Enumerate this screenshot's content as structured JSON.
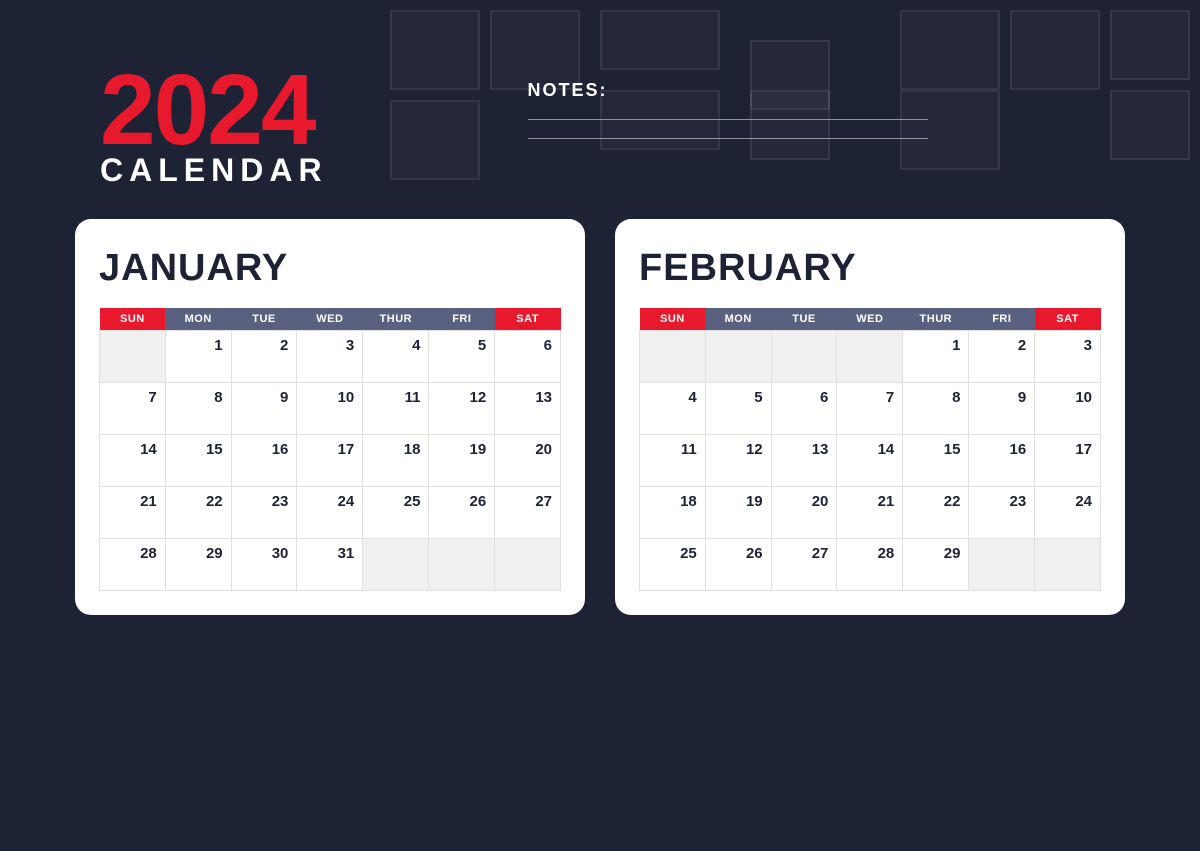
{
  "background": {
    "color": "#1e2235"
  },
  "header": {
    "year": "2024",
    "calendar_label": "CALENDAR",
    "notes_label": "NOTES:"
  },
  "january": {
    "title": "JANUARY",
    "days_header": [
      "SUN",
      "MON",
      "TUE",
      "WED",
      "THUR",
      "FRI",
      "SAT"
    ],
    "weeks": [
      [
        "",
        "1",
        "2",
        "3",
        "4",
        "5",
        "6"
      ],
      [
        "7",
        "8",
        "9",
        "10",
        "11",
        "12",
        "13"
      ],
      [
        "14",
        "15",
        "16",
        "17",
        "18",
        "19",
        "20"
      ],
      [
        "21",
        "22",
        "23",
        "24",
        "25",
        "26",
        "27"
      ],
      [
        "28",
        "29",
        "30",
        "31",
        "",
        "",
        ""
      ]
    ]
  },
  "february": {
    "title": "FEBRUARY",
    "days_header": [
      "SUN",
      "MON",
      "TUE",
      "WED",
      "THUR",
      "FRI",
      "SAT"
    ],
    "weeks": [
      [
        "",
        "",
        "",
        "",
        "1",
        "2",
        "3"
      ],
      [
        "4",
        "5",
        "6",
        "7",
        "8",
        "9",
        "10"
      ],
      [
        "11",
        "12",
        "13",
        "14",
        "15",
        "16",
        "17"
      ],
      [
        "18",
        "19",
        "20",
        "21",
        "22",
        "23",
        "24"
      ],
      [
        "25",
        "26",
        "27",
        "28",
        "29",
        "",
        ""
      ]
    ]
  }
}
